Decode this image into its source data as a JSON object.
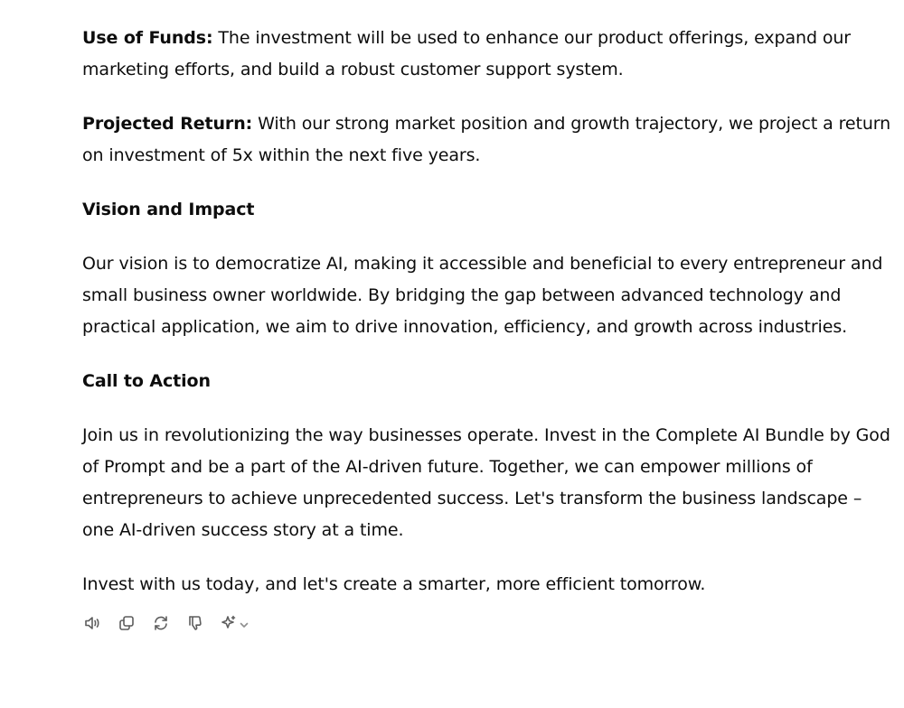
{
  "message": {
    "funds_label": "Use of Funds:",
    "funds_text": " The investment will be used to enhance our product offerings, expand our marketing efforts, and build a robust customer support system.",
    "return_label": "Projected Return:",
    "return_text": " With our strong market position and growth trajectory, we project a return on investment of 5x within the next five years.",
    "vision_heading": "Vision and Impact",
    "vision_text": "Our vision is to democratize AI, making it accessible and beneficial to every entrepreneur and small business owner worldwide. By bridging the gap between advanced technology and practical application, we aim to drive innovation, efficiency, and growth across industries.",
    "cta_heading": "Call to Action",
    "cta_text": "Join us in revolutionizing the way businesses operate. Invest in the Complete AI Bundle by God of Prompt and be a part of the AI-driven future. Together, we can empower millions of entrepreneurs to achieve unprecedented success. Let's transform the business landscape – one AI-driven success story at a time.",
    "closing_text": "Invest with us today, and let's create a smarter, more efficient tomorrow."
  },
  "actions": [
    {
      "name": "read-aloud",
      "icon": "speaker-icon"
    },
    {
      "name": "copy",
      "icon": "copy-icon"
    },
    {
      "name": "regenerate",
      "icon": "refresh-icon"
    },
    {
      "name": "bad-response",
      "icon": "thumbs-down-icon"
    },
    {
      "name": "change-model",
      "icon": "sparkle-icon"
    }
  ]
}
